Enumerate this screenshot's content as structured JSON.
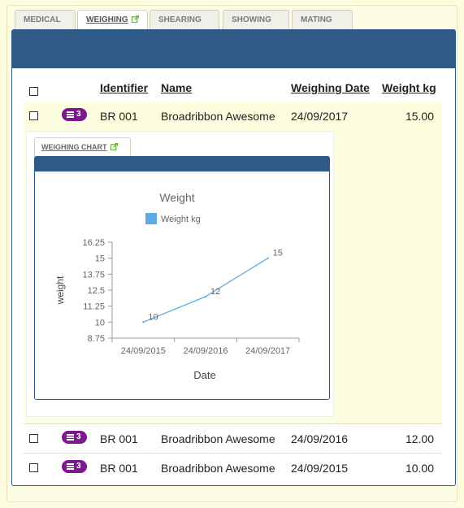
{
  "tabs": [
    {
      "label": "MEDICAL",
      "active": false
    },
    {
      "label": "WEIGHING",
      "active": true
    },
    {
      "label": "SHEARING",
      "active": false
    },
    {
      "label": "SHOWING",
      "active": false
    },
    {
      "label": "MATING",
      "active": false
    }
  ],
  "table": {
    "headers": {
      "identifier": "Identifier",
      "name": "Name",
      "date": "Weighing Date",
      "weight": "Weight kg"
    },
    "rows": [
      {
        "badge": "3",
        "identifier": "BR 001",
        "name": "Broadribbon Awesome",
        "date": "24/09/2017",
        "weight": "15.00"
      },
      {
        "badge": "3",
        "identifier": "BR 001",
        "name": "Broadribbon Awesome",
        "date": "24/09/2016",
        "weight": "12.00"
      },
      {
        "badge": "3",
        "identifier": "BR 001",
        "name": "Broadribbon Awesome",
        "date": "24/09/2015",
        "weight": "10.00"
      }
    ]
  },
  "subtab": {
    "label": "WEIGHING CHART"
  },
  "colors": {
    "header_blue": "#2f5a87",
    "badge_purple": "#7b1a8e",
    "line_blue": "#5dade2",
    "row_highlight": "#fdfde0"
  },
  "chart_data": {
    "type": "line",
    "title": "Weight",
    "xlabel": "Date",
    "ylabel": "weight",
    "categories": [
      "24/09/2015",
      "24/09/2016",
      "24/09/2017"
    ],
    "series": [
      {
        "name": "Weight kg",
        "values": [
          10,
          12,
          15
        ]
      }
    ],
    "data_labels": [
      "10",
      "12",
      "15"
    ],
    "ylim": [
      8.75,
      16.25
    ],
    "yticks": [
      "16.25",
      "15",
      "13.75",
      "12.5",
      "11.25",
      "10",
      "8.75"
    ],
    "legend": "top"
  }
}
